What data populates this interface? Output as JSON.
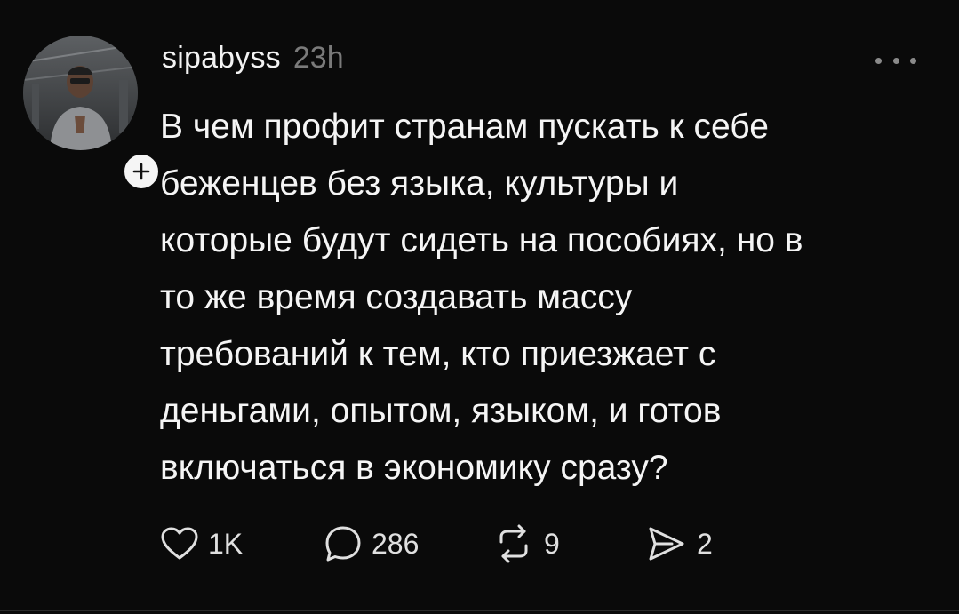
{
  "post": {
    "username": "sipabyss",
    "time": "23h",
    "text": "В чем профит странам пускать к себе\nбеженцев без языка, культуры и\nкоторые будут сидеть на пособиях, но в\nто же время создавать массу\nтребований к тем, кто приезжает с\nденьгами, опытом, языком, и готов\nвключаться в экономику сразу?",
    "actions": {
      "likes": "1K",
      "replies": "286",
      "reposts": "9",
      "shares": "2"
    },
    "icons": {
      "avatar": "user-avatar",
      "follow": "plus-icon",
      "more": "more-horizontal-icon",
      "like": "heart-icon",
      "reply": "comment-bubble-icon",
      "repost": "repost-arrows-icon",
      "share": "send-icon"
    },
    "colors": {
      "background": "#0a0a0a",
      "text": "#f5f5f5",
      "muted": "#7a7a7a"
    }
  }
}
